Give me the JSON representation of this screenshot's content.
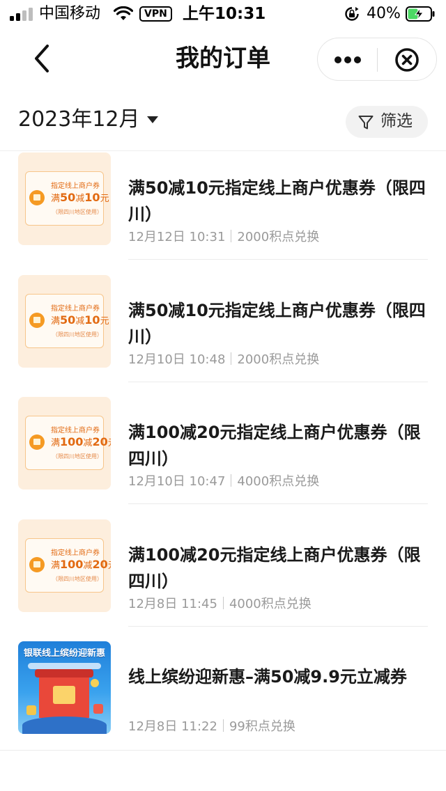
{
  "status_bar": {
    "carrier": "中国移动",
    "vpn": "VPN",
    "time": "上午10:31",
    "battery": "40%"
  },
  "nav": {
    "title": "我的订单",
    "back_icon": "chevron-left-icon",
    "more_icon": "more-dots-icon",
    "close_icon": "close-circle-icon"
  },
  "filter": {
    "month": "2023年12月",
    "filter_label": "筛选"
  },
  "colors": {
    "coupon_bg": "#fdeedd",
    "coupon_accent": "#f59a23",
    "coupon_text": "#e26a12",
    "banner_blue": "#1f7fd9"
  },
  "orders": [
    {
      "thumb": {
        "line1": "指定线上商户券",
        "line2_prefix": "满",
        "line2_a": "50",
        "line2_mid": "减",
        "line2_b": "10",
        "line2_suffix": "元",
        "line3": "（限四川地区使用）"
      },
      "title": "满50减10元指定线上商户优惠券（限四川）",
      "date": "12月12日 10:31",
      "points": "2000积点兑换"
    },
    {
      "thumb": {
        "line1": "指定线上商户券",
        "line2_prefix": "满",
        "line2_a": "50",
        "line2_mid": "减",
        "line2_b": "10",
        "line2_suffix": "元",
        "line3": "（限四川地区使用）"
      },
      "title": "满50减10元指定线上商户优惠券（限四川）",
      "date": "12月10日 10:48",
      "points": "2000积点兑换"
    },
    {
      "thumb": {
        "line1": "指定线上商户券",
        "line2_prefix": "满",
        "line2_a": "100",
        "line2_mid": "减",
        "line2_b": "20",
        "line2_suffix": "元",
        "line3": "（限四川地区使用）"
      },
      "title": "满100减20元指定线上商户优惠券（限四川）",
      "date": "12月10日 10:47",
      "points": "4000积点兑换"
    },
    {
      "thumb": {
        "line1": "指定线上商户券",
        "line2_prefix": "满",
        "line2_a": "100",
        "line2_mid": "减",
        "line2_b": "20",
        "line2_suffix": "元",
        "line3": "（限四川地区使用）"
      },
      "title": "满100减20元指定线上商户优惠券（限四川）",
      "date": "12月8日 11:45",
      "points": "4000积点兑换"
    },
    {
      "thumb": {
        "banner_text": "银联线上缤纷迎新惠"
      },
      "title": "线上缤纷迎新惠–满50减9.9元立减券",
      "date": "12月8日 11:22",
      "points": "99积点兑换"
    }
  ]
}
